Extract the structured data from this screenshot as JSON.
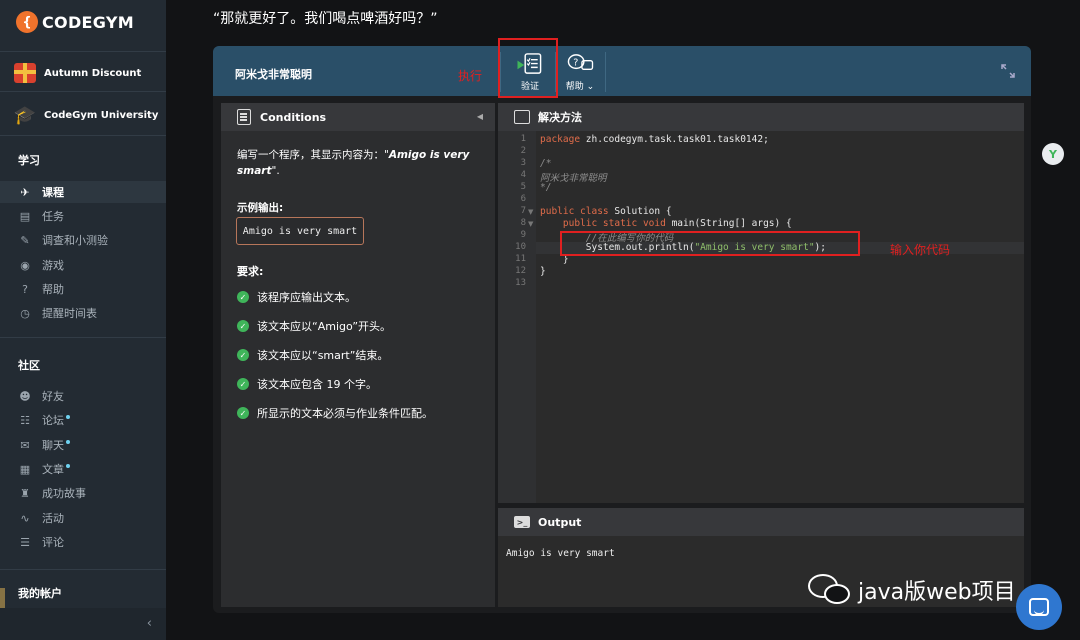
{
  "sidebar": {
    "logo": "CODEGYM",
    "promos": [
      {
        "label": "Autumn Discount",
        "icon": "gift-icon"
      },
      {
        "label": "CodeGym University",
        "icon": "graduation-cap-icon"
      }
    ],
    "sections": [
      {
        "title": "学习",
        "items": [
          {
            "label": "课程",
            "icon": "rocket-icon",
            "active": true
          },
          {
            "label": "任务",
            "icon": "tasks-icon"
          },
          {
            "label": "调查和小测验",
            "icon": "survey-icon"
          },
          {
            "label": "游戏",
            "icon": "gamepad-icon"
          },
          {
            "label": "帮助",
            "icon": "help-icon"
          },
          {
            "label": "提醒时间表",
            "icon": "schedule-icon"
          }
        ]
      },
      {
        "title": "社区",
        "items": [
          {
            "label": "好友",
            "icon": "friends-icon"
          },
          {
            "label": "论坛",
            "icon": "forum-icon",
            "dot": true
          },
          {
            "label": "聊天",
            "icon": "chat-icon",
            "dot": true
          },
          {
            "label": "文章",
            "icon": "articles-icon",
            "dot": true
          },
          {
            "label": "成功故事",
            "icon": "stories-icon"
          },
          {
            "label": "活动",
            "icon": "activity-icon"
          },
          {
            "label": "评论",
            "icon": "reviews-icon"
          }
        ]
      },
      {
        "title": "我的帐户",
        "items": []
      }
    ],
    "collapse": "‹"
  },
  "header": {
    "quote": "“那就更好了。我们喝点啤酒好吗？”"
  },
  "task": {
    "title": "阿米戈非常聪明",
    "verify_label": "验证",
    "help_label": "帮助 ⌄"
  },
  "annotations": {
    "run": "执行",
    "input_code": "输入你代码"
  },
  "conditions": {
    "title": "Conditions",
    "desc_prefix": "编写一个程序，其显示内容为：\"",
    "desc_em": "Amigo is very smart",
    "desc_suffix": "\".",
    "sample_label": "示例输出:",
    "sample_output": "Amigo is very smart",
    "requirements_label": "要求:",
    "requirements": [
      "该程序应输出文本。",
      "该文本应以“Amigo”开头。",
      "该文本应以“smart”结束。",
      "该文本应包含 19 个字。",
      "所显示的文本必须与作业条件匹配。"
    ]
  },
  "editor": {
    "title": "解决方法",
    "line_numbers": [
      "1",
      "2",
      "3",
      "4",
      "5",
      "6",
      "7",
      "8",
      "9",
      "10",
      "11",
      "12",
      "13"
    ],
    "lines": {
      "l1_kw": "package",
      "l1_rest": " zh.codegym.task.task01.task0142;",
      "l3": "/*",
      "l4": "阿米戈非常聪明",
      "l5": "*/",
      "l7_kw": "public class",
      "l7_rest": " Solution {",
      "l8_ind": "    ",
      "l8_kw": "public static void",
      "l8_rest": " main(String[] args) {",
      "l9": "        //在此编写你的代码",
      "l10_pre": "        System.out.println(",
      "l10_str": "\"Amigo is very smart\"",
      "l10_post": ");",
      "l11": "    }",
      "l12": "}"
    }
  },
  "output": {
    "title": "Output",
    "text": "Amigo is very smart"
  },
  "watermark": "java版web项目",
  "ext_badge": "Y"
}
